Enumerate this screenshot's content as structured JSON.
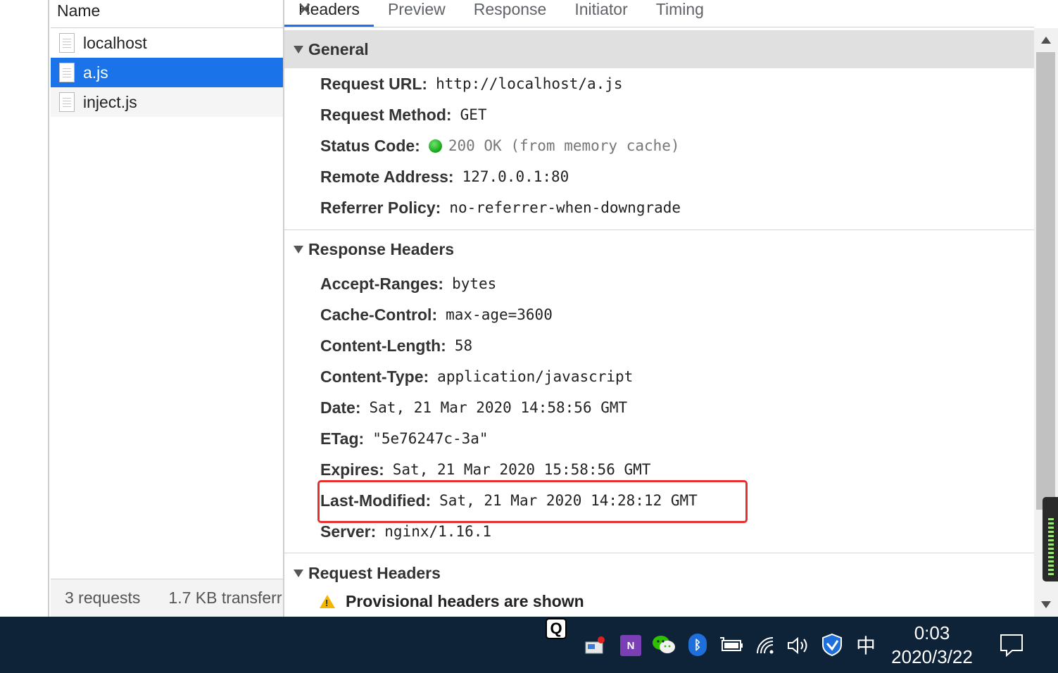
{
  "name_panel": {
    "header": "Name",
    "requests": [
      {
        "name": "localhost",
        "selected": false
      },
      {
        "name": "a.js",
        "selected": true
      },
      {
        "name": "inject.js",
        "selected": false
      }
    ],
    "footer": {
      "requests": "3 requests",
      "transferred": "1.7 KB transferr"
    }
  },
  "tabs": [
    "Headers",
    "Preview",
    "Response",
    "Initiator",
    "Timing"
  ],
  "active_tab": "Headers",
  "general": {
    "title": "General",
    "rows": [
      {
        "name": "Request URL:",
        "value": "http://localhost/a.js"
      },
      {
        "name": "Request Method:",
        "value": "GET"
      },
      {
        "name": "Status Code:",
        "value": "200 OK (from memory cache)"
      },
      {
        "name": "Remote Address:",
        "value": "127.0.0.1:80"
      },
      {
        "name": "Referrer Policy:",
        "value": "no-referrer-when-downgrade"
      }
    ]
  },
  "response_headers": {
    "title": "Response Headers",
    "rows": [
      {
        "name": "Accept-Ranges:",
        "value": "bytes"
      },
      {
        "name": "Cache-Control:",
        "value": "max-age=3600"
      },
      {
        "name": "Content-Length:",
        "value": "58"
      },
      {
        "name": "Content-Type:",
        "value": "application/javascript"
      },
      {
        "name": "Date:",
        "value": "Sat, 21 Mar 2020 14:58:56 GMT"
      },
      {
        "name": "ETag:",
        "value": "\"5e76247c-3a\""
      },
      {
        "name": "Expires:",
        "value": "Sat, 21 Mar 2020 15:58:56 GMT"
      },
      {
        "name": "Last-Modified:",
        "value": "Sat, 21 Mar 2020 14:28:12 GMT"
      },
      {
        "name": "Server:",
        "value": "nginx/1.16.1"
      }
    ]
  },
  "request_headers": {
    "title": "Request Headers",
    "warning": "Provisional headers are shown"
  },
  "taskbar": {
    "q_label": "Q",
    "onenote_label": "N",
    "bluetooth_label": "ᛒ",
    "ime_label": "中",
    "time": "0:03",
    "date": "2020/3/22"
  },
  "colors": {
    "accent": "#1a73e8",
    "highlight": "#e53030",
    "status_ok": "#14a314",
    "taskbar": "#0e2238"
  }
}
